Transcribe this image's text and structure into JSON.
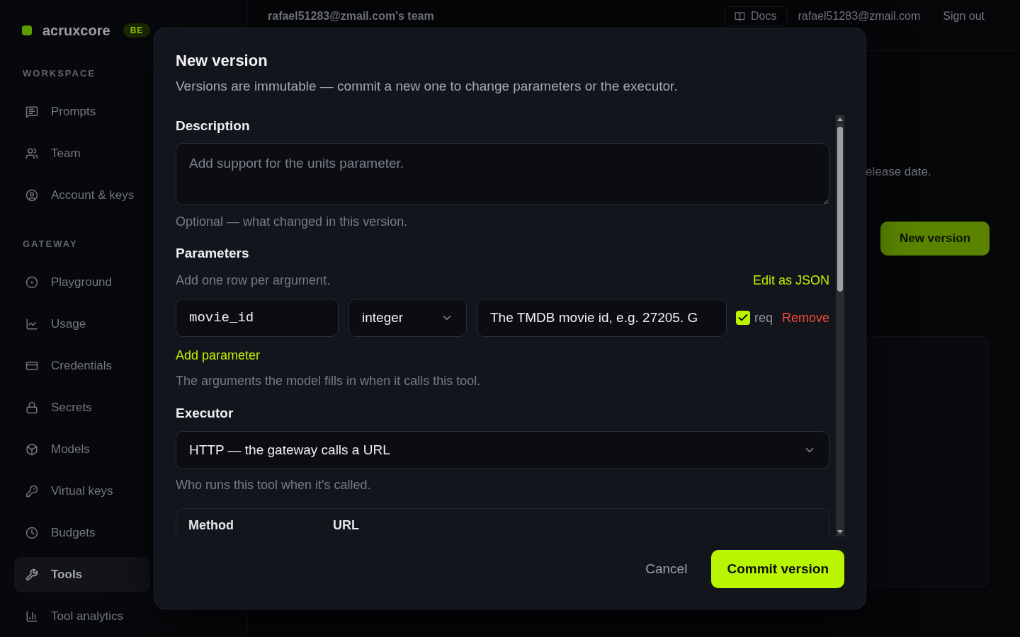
{
  "sidebar": {
    "logo": "acruxcore",
    "badge": "BE",
    "sections": [
      {
        "title": "WORKSPACE",
        "items": [
          {
            "label": "Prompts",
            "selected": false
          },
          {
            "label": "Team",
            "selected": false
          },
          {
            "label": "Account & keys",
            "selected": false
          }
        ]
      },
      {
        "title": "GATEWAY",
        "items": [
          {
            "label": "Playground",
            "selected": false
          },
          {
            "label": "Usage",
            "selected": false
          },
          {
            "label": "Credentials",
            "selected": false
          },
          {
            "label": "Secrets",
            "selected": false
          },
          {
            "label": "Models",
            "selected": false
          },
          {
            "label": "Virtual keys",
            "selected": false
          },
          {
            "label": "Budgets",
            "selected": false
          },
          {
            "label": "Tools",
            "selected": true
          },
          {
            "label": "Tool analytics",
            "selected": false
          }
        ]
      }
    ]
  },
  "header": {
    "team": "rafael51283@zmail.com's team",
    "docs": "Docs",
    "email": "rafael51283@zmail.com",
    "sign_out": "Sign out"
  },
  "page": {
    "description": "elease date.",
    "new_version_button": "New version"
  },
  "dialog": {
    "title": "New version",
    "subtitle": "Versions are immutable — commit a new one to change parameters or the executor.",
    "description": {
      "label": "Description",
      "placeholder": "Add support for the units parameter.",
      "help": "Optional — what changed in this version."
    },
    "parameters": {
      "label": "Parameters",
      "hint": "Add one row per argument.",
      "edit_json": "Edit as JSON",
      "rows": [
        {
          "name": "movie_id",
          "type": "integer",
          "description": "The TMDB movie id, e.g. 27205. G",
          "required": true,
          "required_label": "req",
          "remove": "Remove"
        }
      ],
      "add": "Add parameter",
      "help": "The arguments the model fills in when it calls this tool."
    },
    "executor": {
      "label": "Executor",
      "value": "HTTP — the gateway calls a URL",
      "help": "Who runs this tool when it's called.",
      "fields": [
        "Method",
        "URL"
      ]
    },
    "buttons": [
      {
        "label": "Cancel",
        "kind": "ghost"
      },
      {
        "label": "Commit version",
        "kind": "primary"
      }
    ]
  }
}
